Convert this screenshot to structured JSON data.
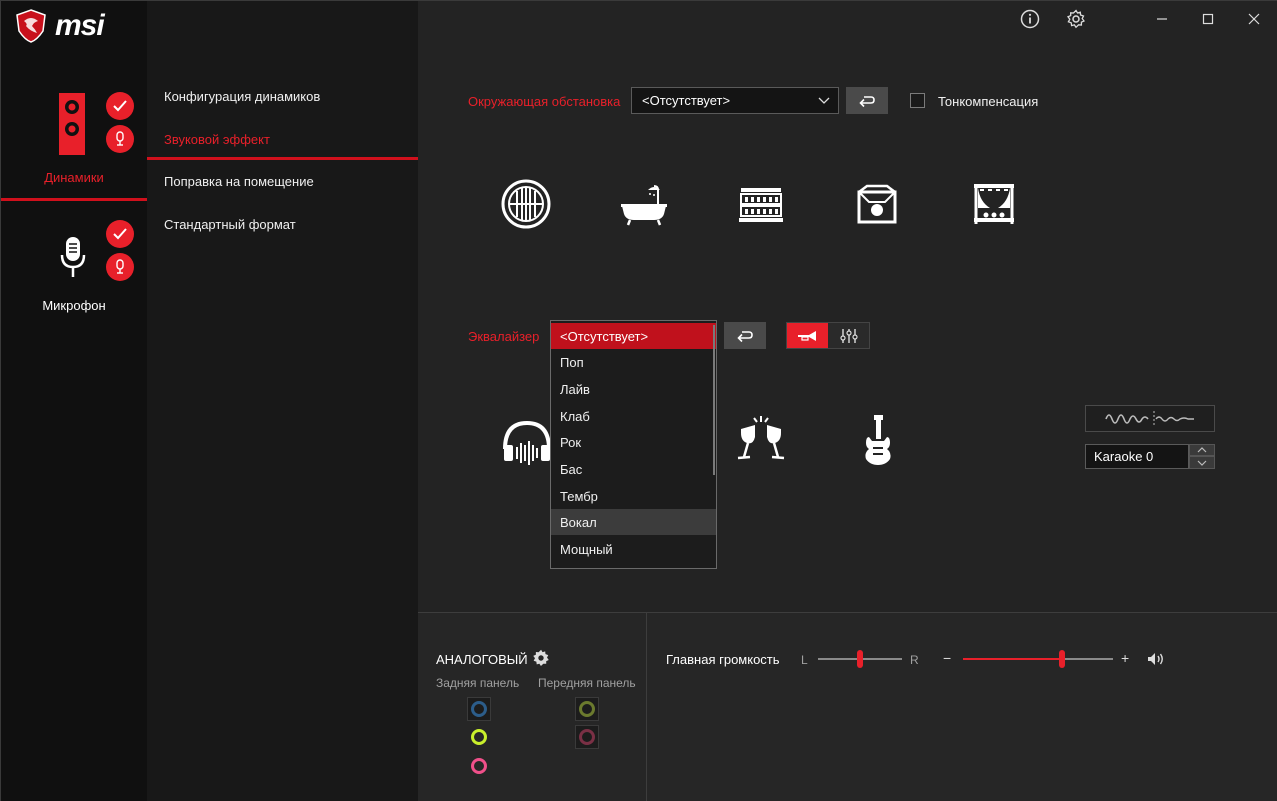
{
  "app": {
    "logo_text": "msi",
    "colors": {
      "accent": "#e8202a",
      "bg": "#232323",
      "sidebar": "#101010"
    }
  },
  "devices": {
    "speakers_label": "Динамики",
    "microphone_label": "Микрофон"
  },
  "menu": {
    "items": [
      {
        "label": "Конфигурация динамиков"
      },
      {
        "label": "Звуковой эффект"
      },
      {
        "label": "Поправка на помещение"
      },
      {
        "label": "Стандартный формат"
      }
    ],
    "active_index": 1
  },
  "titlebar": {
    "icons": [
      "info-icon",
      "gear-icon",
      "minimize-icon",
      "maximize-icon",
      "close-icon"
    ]
  },
  "environment": {
    "label": "Окружающая обстановка",
    "selected": "<Отсутствует>",
    "loudness_label": "Тонкомпенсация",
    "loudness_checked": false,
    "icons": [
      "sphere-icon",
      "bathtub-icon",
      "colosseum-icon",
      "stage-room-icon",
      "theater-icon"
    ]
  },
  "equalizer": {
    "label": "Эквалайзер",
    "options": [
      "<Отсутствует>",
      "Поп",
      "Лайв",
      "Клаб",
      "Рок",
      "Бас",
      "Тембр",
      "Вокал",
      "Мощный"
    ],
    "selected_index": 0,
    "hover_index": 7,
    "mode_toggle": [
      "trumpet-icon",
      "equalizer-sliders-icon"
    ],
    "active_mode": 0,
    "icons": [
      "headphones-icon",
      "cheers-icon",
      "guitar-icon"
    ]
  },
  "karaoke": {
    "value": "Karaoke 0",
    "wave_icon": "voice-wave-icon"
  },
  "analog": {
    "title": "АНАЛОГОВЫЙ",
    "rear_label": "Задняя панель",
    "front_label": "Передняя панель",
    "rear_jacks": [
      {
        "color": "#2c5d8a",
        "enabled": false
      },
      {
        "color": "#c9ef2c",
        "enabled": true
      },
      {
        "color": "#f0508a",
        "enabled": true
      }
    ],
    "front_jacks": [
      {
        "color": "#6b7a2e",
        "enabled": false
      },
      {
        "color": "#7a3045",
        "enabled": false
      }
    ]
  },
  "volume": {
    "label": "Главная громкость",
    "balance_left": "L",
    "balance_right": "R",
    "balance_value": 0.5,
    "minus": "−",
    "plus": "+",
    "volume_value": 0.66
  }
}
